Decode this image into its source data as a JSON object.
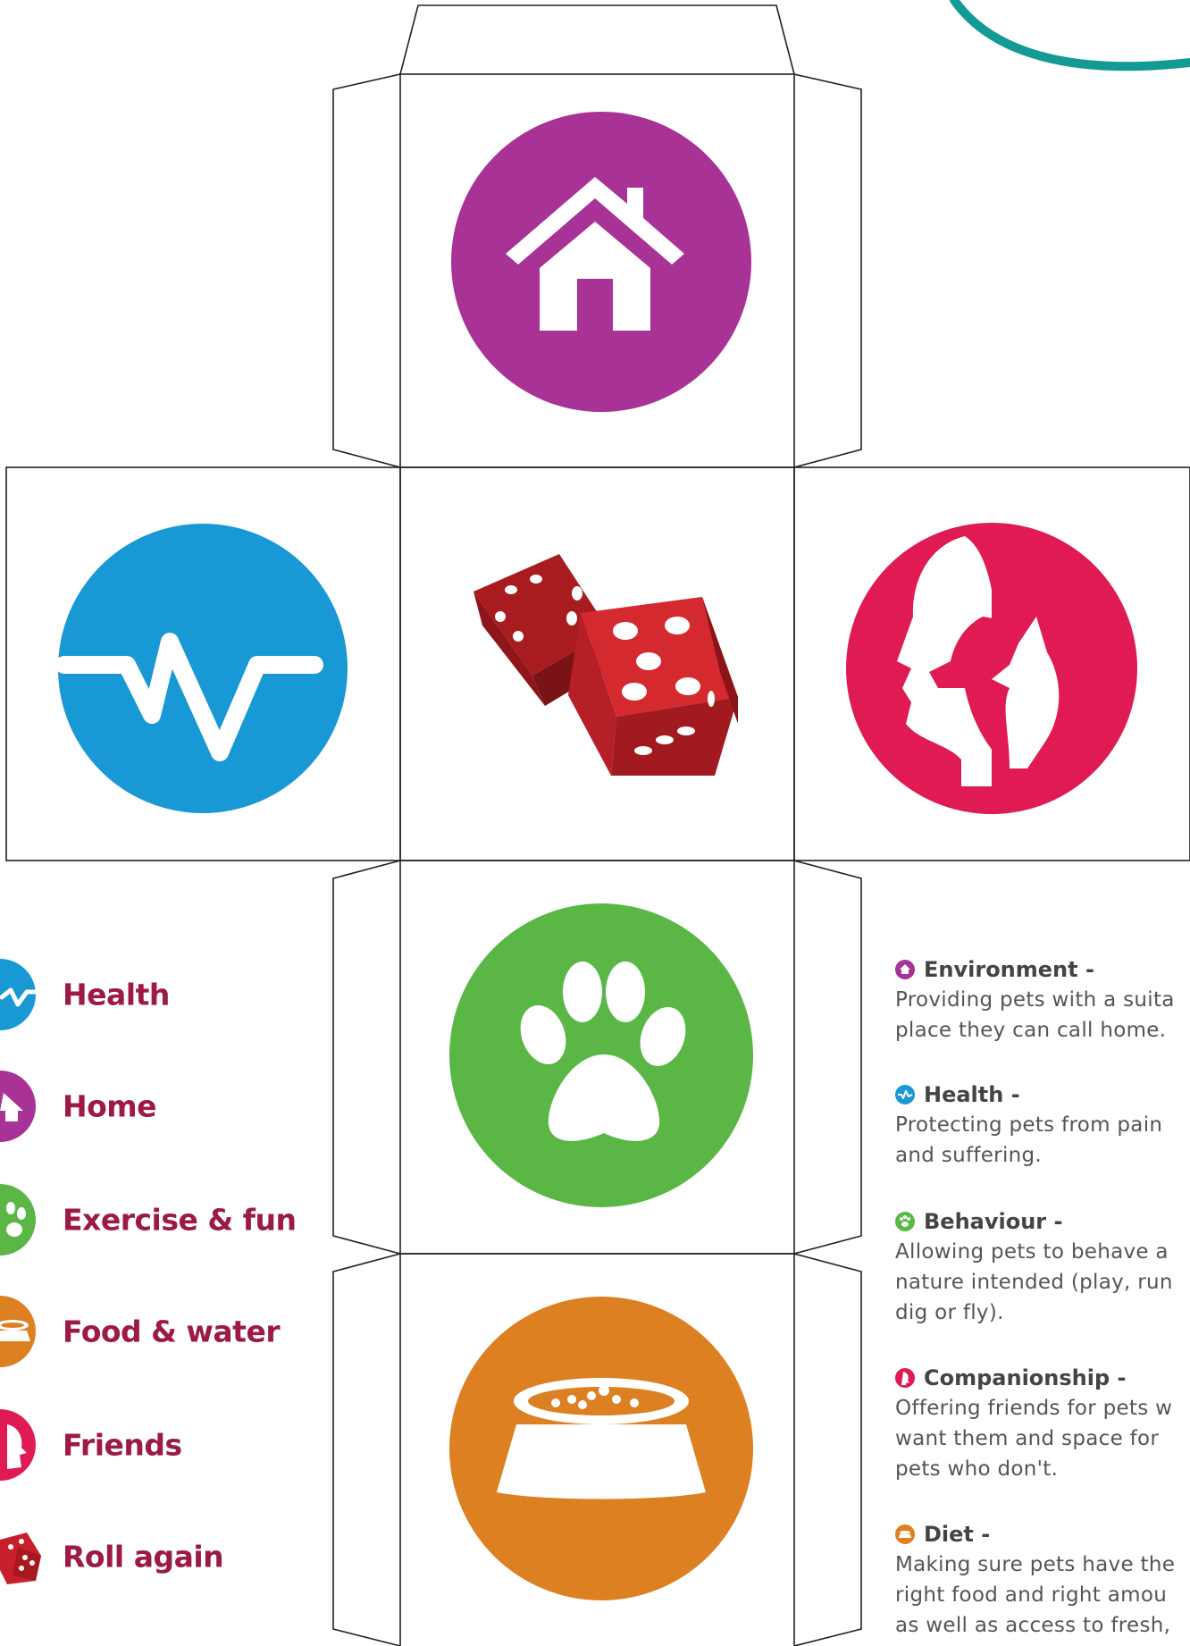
{
  "legend": [
    {
      "icon": "health-icon",
      "label": "Health",
      "color": "#1898d5"
    },
    {
      "icon": "home-icon",
      "label": "Home",
      "color": "#a83295"
    },
    {
      "icon": "paw-icon",
      "label": "Exercise & fun",
      "color": "#5ab746"
    },
    {
      "icon": "food-bowl-icon",
      "label": "Food & water",
      "color": "#dc8022"
    },
    {
      "icon": "friends-icon",
      "label": "Friends",
      "color": "#e01a52"
    },
    {
      "icon": "dice-icon",
      "label": "Roll again",
      "color": "#c8202a"
    }
  ],
  "faces": {
    "top": {
      "icon": "home-icon",
      "color": "#a83295"
    },
    "left": {
      "icon": "health-icon",
      "color": "#1898d5"
    },
    "center": {
      "icon": "dice-icon",
      "color": "#d42a2f"
    },
    "right": {
      "icon": "friends-icon",
      "color": "#e01a52"
    },
    "lower": {
      "icon": "paw-icon",
      "color": "#5ab746"
    },
    "bottom": {
      "icon": "food-bowl-icon",
      "color": "#dc8022"
    }
  },
  "info": [
    {
      "icon": "home-icon",
      "color": "#a83295",
      "title": "Environment -",
      "lines": [
        "Providing pets with a suita",
        "place they can call home."
      ]
    },
    {
      "icon": "health-icon",
      "color": "#1898d5",
      "title": "Health -",
      "lines": [
        "Protecting pets from pain",
        "and suffering."
      ]
    },
    {
      "icon": "paw-icon",
      "color": "#5ab746",
      "title": "Behaviour -",
      "lines": [
        "Allowing pets to behave a",
        "nature intended (play, run",
        "dig or fly)."
      ]
    },
    {
      "icon": "friends-icon",
      "color": "#e01a52",
      "title": "Companionship -",
      "lines": [
        "Offering friends for pets w",
        "want them and space for",
        "pets who don't."
      ]
    },
    {
      "icon": "food-bowl-icon",
      "color": "#dc8022",
      "title": "Diet -",
      "lines": [
        "Making sure pets have the",
        "right food and right amou",
        "as well as access to fresh,"
      ]
    }
  ],
  "colors": {
    "accent_arc": "#139a95",
    "label_text": "#9c1a45",
    "outline": "#222222"
  }
}
